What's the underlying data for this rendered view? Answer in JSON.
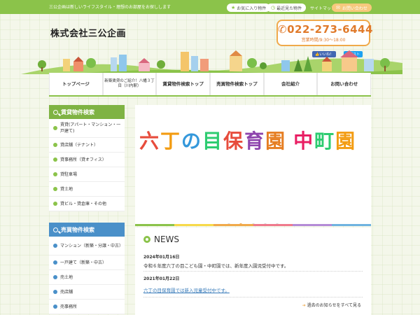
{
  "topbar": {
    "tagline": "三公企画は新しいライフスタイル・理想のお部屋をお探しします",
    "favorites_label": "お気に入り物件",
    "recent_label": "最近見た物件",
    "sitemap_label": "サイトマップ",
    "contact_label": "お問い合わせ"
  },
  "header": {
    "company_name": "株式会社三公企画",
    "phone": "022-273-6444",
    "hours": "営業時間/9:30～18:00",
    "facebook_label": "いいね！",
    "twitter_label": "ポスト"
  },
  "nav": [
    {
      "label": "トップページ"
    },
    {
      "label": "新築賃貸のご紹介！八幡３丁目（川内駅）"
    },
    {
      "label": "賃貸物件検索トップ"
    },
    {
      "label": "売買物件検索トップ"
    },
    {
      "label": "会社紹介"
    },
    {
      "label": "お問い合わせ"
    }
  ],
  "sidebar_rent": {
    "heading": "賃貸物件検索",
    "items": [
      {
        "label": "賃貸(アパート・マンション・一戸建て)"
      },
      {
        "label": "貸店舗（テナント）"
      },
      {
        "label": "貸事務所（貸オフィス）"
      },
      {
        "label": "貸駐車場"
      },
      {
        "label": "貸土地"
      },
      {
        "label": "貸ビル・貸倉庫・その他"
      }
    ]
  },
  "sidebar_sale": {
    "heading": "売買物件検索",
    "items": [
      {
        "label": "マンション（新築・分譲・中古）"
      },
      {
        "label": "一戸建て（新築・中古）"
      },
      {
        "label": "売土地"
      },
      {
        "label": "売店舗"
      },
      {
        "label": "売事務所"
      }
    ]
  },
  "slider": {
    "text": "六丁の目保育園 中町園",
    "colors": [
      "#e74c3c",
      "#f39c12",
      "#3498db",
      "#2ecc71",
      "#e74c3c",
      "#8e44ad",
      "#e67e22",
      "#e91e63",
      "#2ecc71",
      "#f39c12",
      "#3498db"
    ]
  },
  "news": {
    "title": "NEWS",
    "items": [
      {
        "date": "2024年01月16日",
        "text": "令和６年度六丁の目こども園・中町園では、新年度入園児受付中です。"
      },
      {
        "date": "2021年01月22日",
        "text": "六丁の目保育園では新入児童受付中です。"
      }
    ],
    "more_label": "過去のお知らせをすべて見る"
  },
  "colors": {
    "accent_green": "#8bc34a",
    "accent_blue": "#4a90c9",
    "accent_orange": "#f0a94a"
  }
}
